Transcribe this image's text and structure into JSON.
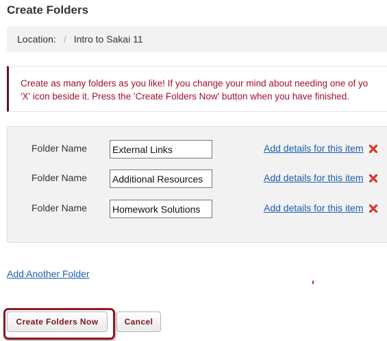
{
  "page": {
    "title": "Create Folders"
  },
  "breadcrumb": {
    "location_label": "Location:",
    "separator": "/",
    "current": "Intro to Sakai 11"
  },
  "instructions": {
    "line1": "Create as many folders as you like! If you change your mind about needing one of yo",
    "line2": "'X' icon beside it. Press the 'Create Folders Now' button when you have finished."
  },
  "folders": {
    "rows": [
      {
        "label": "Folder Name",
        "value": "External Links",
        "details_link": "Add details for this item",
        "remove_icon": "close-x-icon"
      },
      {
        "label": "Folder Name",
        "value": "Additional Resources",
        "details_link": "Add details for this item",
        "remove_icon": "close-x-icon"
      },
      {
        "label": "Folder Name",
        "value": "Homework Solutions",
        "details_link": "Add details for this item",
        "remove_icon": "close-x-icon"
      }
    ]
  },
  "actions": {
    "add_another": "Add Another Folder",
    "create_label": "Create Folders Now",
    "cancel_label": "Cancel"
  },
  "colors": {
    "accent": "#8b1a22",
    "instruction_text": "#a30f2d",
    "link": "#1a5fae",
    "remove_icon": "#d9352b",
    "panel_bg": "#f2f2f2"
  }
}
